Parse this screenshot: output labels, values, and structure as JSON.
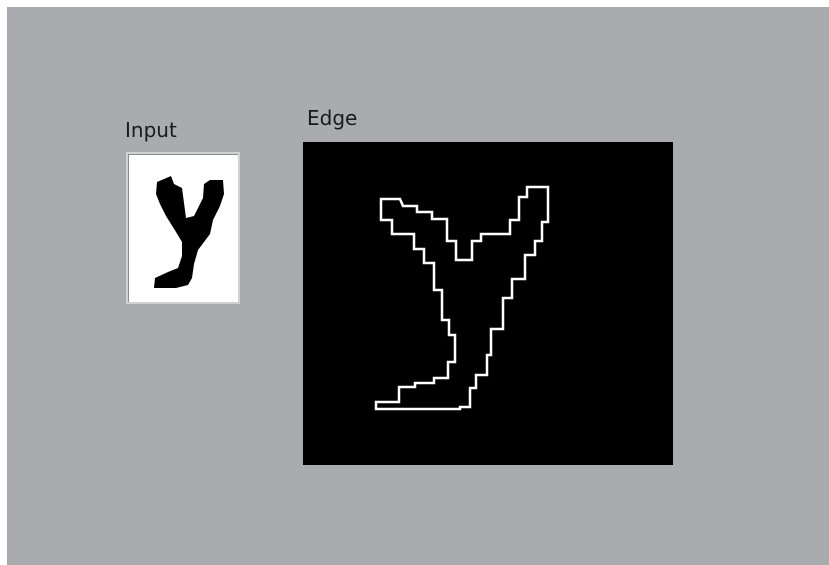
{
  "labels": {
    "input": "Input",
    "edge": "Edge"
  },
  "colors": {
    "background": "#a9abae",
    "input_bg": "#ffffff",
    "glyph": "#000000",
    "edge_bg": "#000000",
    "edge_stroke": "#ffffff"
  }
}
